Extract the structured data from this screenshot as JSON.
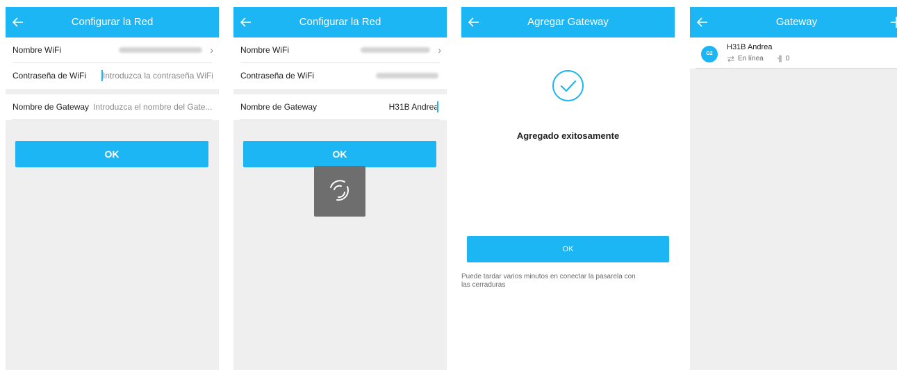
{
  "screens": [
    {
      "title": "Configurar la Red",
      "rows": [
        {
          "label": "Nombre WiFi",
          "chevron": "›"
        },
        {
          "label": "Contraseña de WiFi",
          "placeholder": "Introduzca la contraseña WiFi"
        },
        {
          "label": "Nombre de Gateway",
          "placeholder": "Introduzca el nombre del Gate..."
        }
      ],
      "ok_label": "OK"
    },
    {
      "title": "Configurar la Red",
      "rows": [
        {
          "label": "Nombre WiFi",
          "chevron": "›"
        },
        {
          "label": "Contraseña de WiFi"
        },
        {
          "label": "Nombre de Gateway",
          "value": "H31B Andrea"
        }
      ],
      "ok_label": "OK"
    },
    {
      "title": "Agregar Gateway",
      "success_text": "Agregado exitosamente",
      "ok_label": "OK",
      "note": "Puede tardar varios minutos en conectar la pasarela con las cerraduras"
    },
    {
      "title": "Gateway",
      "gateway": {
        "avatar": "G2",
        "name": "H31B Andrea",
        "status": "En línea",
        "lock_count": "0"
      }
    }
  ],
  "icons": {
    "back": "back-arrow-icon",
    "add": "plus-icon",
    "success": "check-circle-icon",
    "loading": "spinner-icon",
    "status": "swap-arrows-icon",
    "lock": "lock-icon"
  },
  "colors": {
    "accent": "#1bb6f3",
    "background": "#efefef",
    "spinner_bg": "#6e6e6e"
  }
}
